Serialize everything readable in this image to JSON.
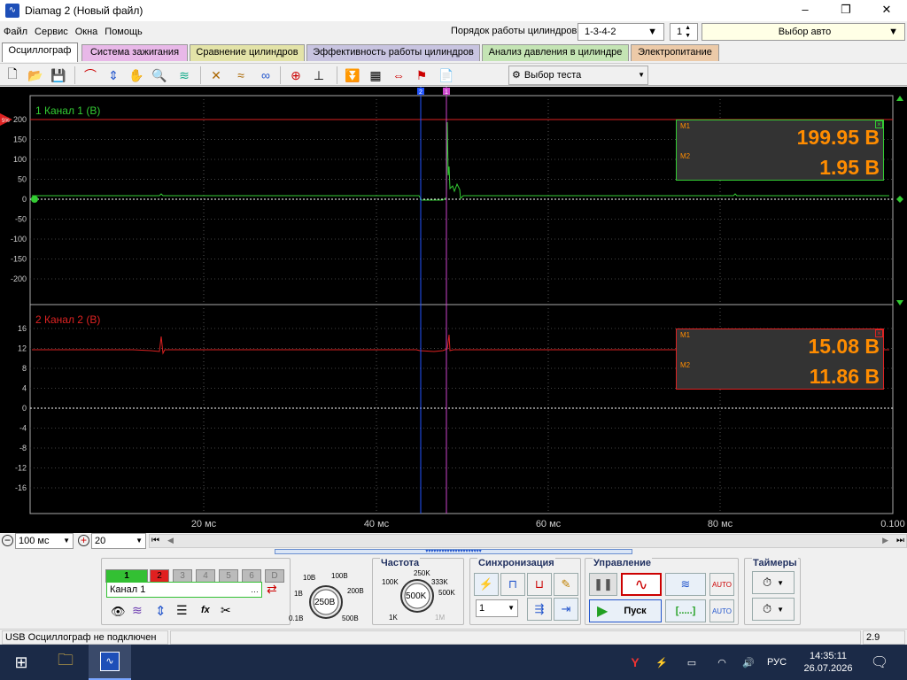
{
  "window": {
    "title": "Diamag 2 (Новый файл)",
    "app_icon": "oscilloscope-app-icon",
    "minimize": "–",
    "maximize": "❐",
    "close": "✕"
  },
  "menu": {
    "items": [
      "Файл",
      "Сервис",
      "Окна",
      "Помощь"
    ],
    "order_label": "Порядок работы цилиндров",
    "order_value": "1-3-4-2",
    "cylinder_value": "1",
    "auto_select": "Выбор авто"
  },
  "tabs": [
    {
      "label": "Осциллограф",
      "color": "#ffffff",
      "active": true
    },
    {
      "label": "Система зажигания",
      "color": "#e8b8e8"
    },
    {
      "label": "Сравнение цилиндров",
      "color": "#e3e3a8"
    },
    {
      "label": "Эффективность работы цилиндров",
      "color": "#c8c4e0"
    },
    {
      "label": "Анализ давления в цилиндре",
      "color": "#c4e4b4"
    },
    {
      "label": "Электропитание",
      "color": "#eccaa8"
    }
  ],
  "toolbar": {
    "test_select": "Выбор теста"
  },
  "scope": {
    "channel1": {
      "label": "1 Канал 1 (В)",
      "color": "#33cc33",
      "ticks": [
        "200",
        "150",
        "100",
        "50",
        "0",
        "-50",
        "-100",
        "-150",
        "-200"
      ],
      "m1_label": "M1",
      "m2_label": "M2",
      "m1_value": "199.95 В",
      "m2_value": "1.95 В",
      "trigger_marker": "5%"
    },
    "channel2": {
      "label": "2 Канал 2 (В)",
      "color": "#dd2222",
      "ticks": [
        "16",
        "12",
        "8",
        "4",
        "0",
        "-4",
        "-8",
        "-12",
        "-16"
      ],
      "m1_label": "M1",
      "m2_label": "M2",
      "m1_value": "15.08 В",
      "m2_value": "11.86 В"
    },
    "time_ticks": [
      "20 мс",
      "40 мс",
      "60 мс",
      "80 мс",
      "0.100"
    ],
    "marker1": "1",
    "marker2": "2",
    "measurement_color": "#ff8c00"
  },
  "scroll": {
    "timebase": "100 мс",
    "zoom": "20"
  },
  "controls": {
    "channels": [
      "1",
      "2",
      "3",
      "4",
      "5",
      "6",
      "D"
    ],
    "channel_name": "Канал 1",
    "voltage_knob": {
      "value": "250В",
      "labels": [
        "10В",
        "100В",
        "1В",
        "200В",
        "0.1В",
        "500В"
      ]
    },
    "frequency": {
      "title": "Частота",
      "value": "500K",
      "labels": [
        "250K",
        "100K",
        "333K",
        "500K",
        "1K",
        "1M"
      ]
    },
    "sync": {
      "title": "Синхронизация",
      "channel": "1"
    },
    "control": {
      "title": "Управление",
      "start": "Пуск",
      "dots": "[.....]"
    },
    "timers": {
      "title": "Таймеры"
    }
  },
  "status": {
    "text": "USB Осциллограф не подключен",
    "version": "2.9"
  },
  "taskbar": {
    "lang": "РУС",
    "time": "14:35:11",
    "date": "26.07.2026"
  }
}
